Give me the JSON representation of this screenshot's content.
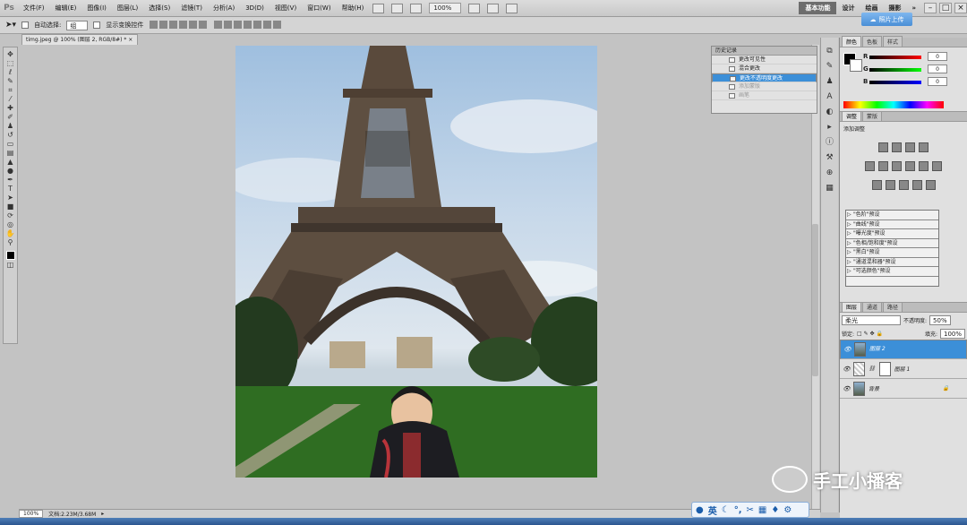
{
  "menubar": {
    "logo": "Ps",
    "items": [
      "文件(F)",
      "编辑(E)",
      "图像(I)",
      "图层(L)",
      "选择(S)",
      "滤镜(T)",
      "分析(A)",
      "3D(D)",
      "视图(V)",
      "窗口(W)",
      "帮助(H)"
    ],
    "zoom": "100%",
    "workspace_active": "基本功能",
    "workspaces": [
      "设计",
      "绘画",
      "摄影"
    ],
    "more": "»",
    "upload_label": "照片上传"
  },
  "options": {
    "auto_select_label": "自动选择:",
    "auto_select_value": "组",
    "show_transform_label": "显示变换控件"
  },
  "document": {
    "tab_title": "timg.jpeg @ 100% (图层 2, RGB/8#) *",
    "status_zoom": "100%",
    "status_doc": "文档:2.23M/3.68M"
  },
  "history": {
    "tab": "历史记录",
    "rows": [
      {
        "label": "更改可见性",
        "state": "normal"
      },
      {
        "label": "混合更改",
        "state": "normal"
      },
      {
        "label": "更改不透明度更改",
        "state": "selected"
      },
      {
        "label": "添加蒙版",
        "state": "dim"
      },
      {
        "label": "画笔",
        "state": "dim"
      }
    ]
  },
  "color_panel": {
    "tabs": [
      "颜色",
      "色板",
      "样式"
    ],
    "r_label": "R",
    "g_label": "G",
    "b_label": "B",
    "r": "0",
    "g": "0",
    "b": "0"
  },
  "adjust_panel": {
    "tabs": [
      "调整",
      "蒙版"
    ],
    "title": "添加调整",
    "presets": [
      "\"色阶\"预设",
      "\"曲线\"预设",
      "\"曝光度\"预设",
      "\"色相/饱和度\"预设",
      "\"黑白\"预设",
      "\"通道混和器\"预设",
      "\"可选颜色\"预设"
    ]
  },
  "layers_panel": {
    "tabs": [
      "图层",
      "通道",
      "路径"
    ],
    "blend_mode": "柔光",
    "opacity_label": "不透明度:",
    "opacity": "50%",
    "lock_label": "锁定:",
    "fill_label": "填充:",
    "fill": "100%",
    "layers": [
      {
        "name": "图层 2",
        "selected": true,
        "kind": "photo"
      },
      {
        "name": "图层 1",
        "selected": false,
        "kind": "mask"
      },
      {
        "name": "背景",
        "selected": false,
        "kind": "photo"
      }
    ]
  },
  "watermark": "手工小播客",
  "ime": {
    "lang": "英"
  },
  "colors": {
    "accent": "#3c8fd8",
    "workspace_bg": "#c3c3c3"
  }
}
